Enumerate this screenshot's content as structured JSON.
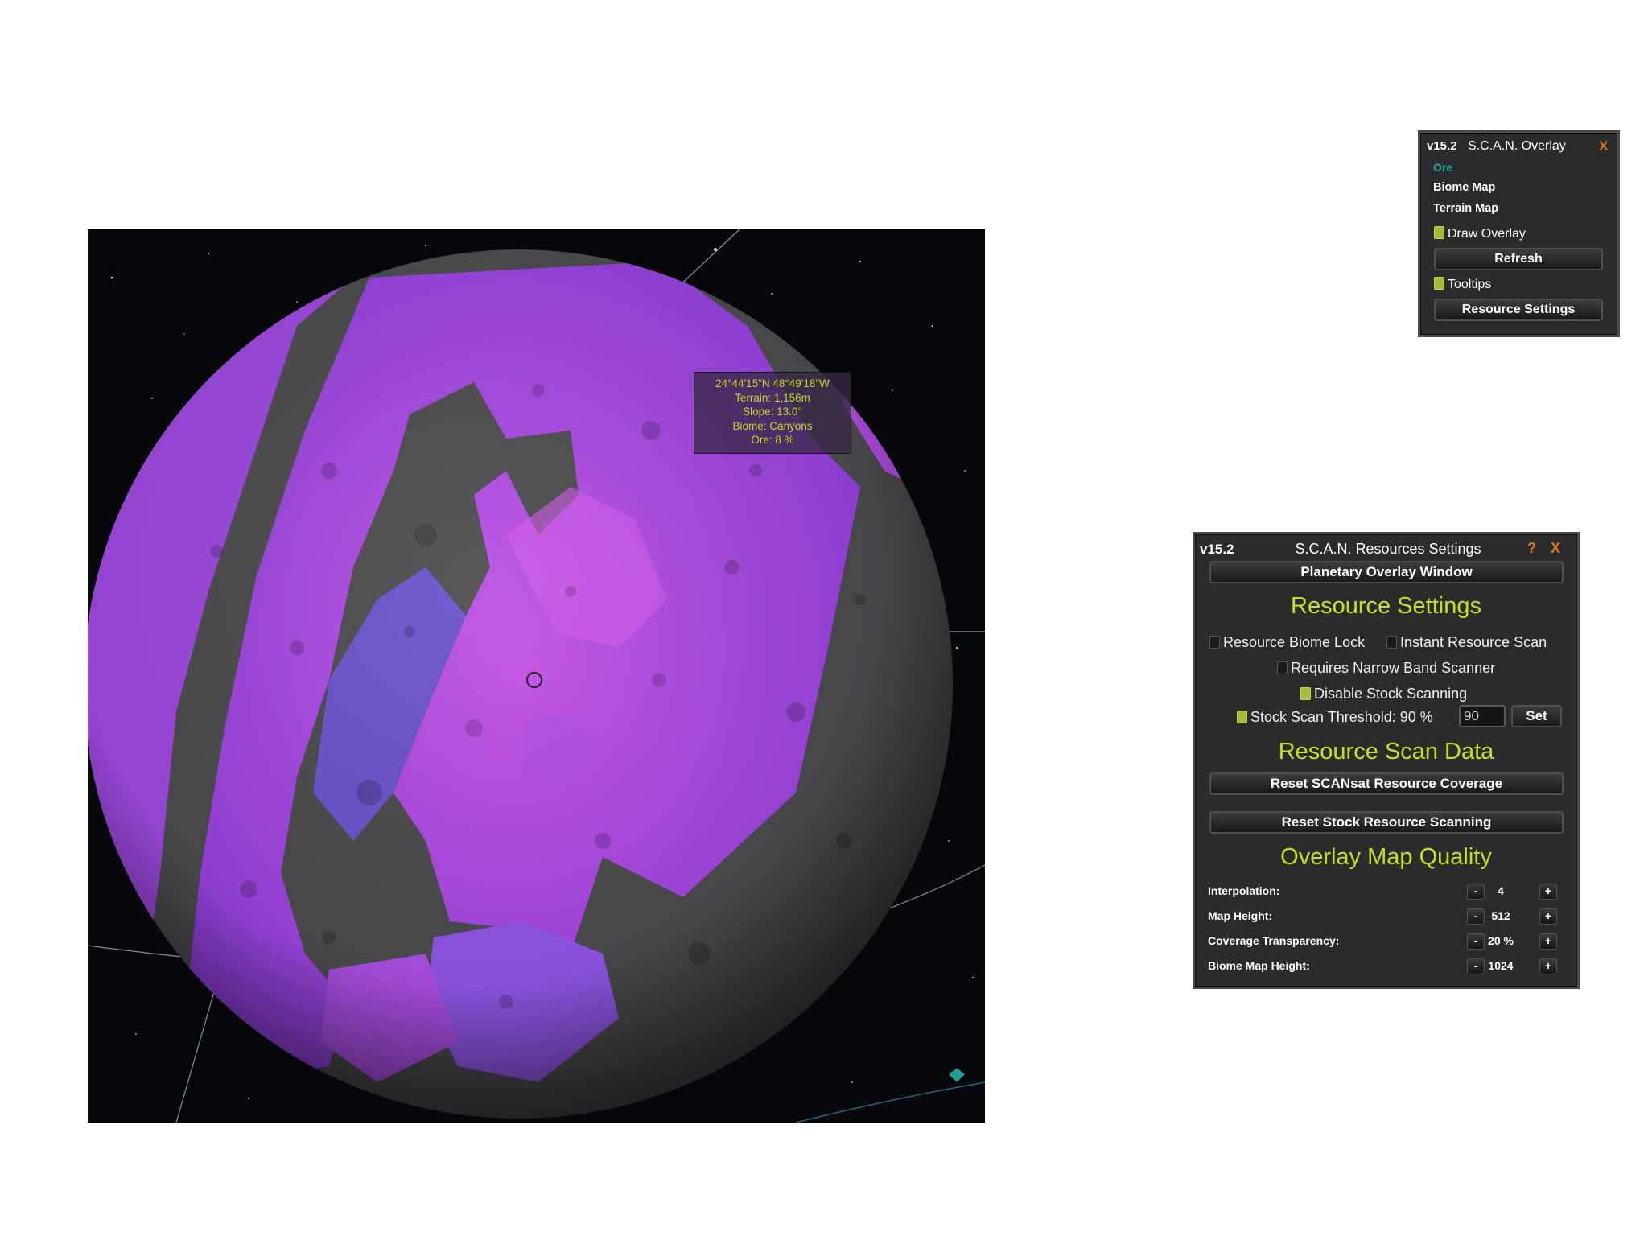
{
  "tooltip": {
    "coords": "24°44'15\"N 48°49'18\"W",
    "terrain": "Terrain: 1,156m",
    "slope": "Slope: 13.0°",
    "biome": "Biome: Canyons",
    "ore": "Ore: 8 %"
  },
  "overlay_window": {
    "version": "v15.2",
    "title": "S.C.A.N. Overlay",
    "close": "X",
    "resource": "Ore",
    "items": [
      "Biome Map",
      "Terrain Map"
    ],
    "draw_overlay": "Draw Overlay",
    "refresh": "Refresh",
    "tooltips": "Tooltips",
    "resource_settings": "Resource Settings"
  },
  "resource_window": {
    "version": "v15.2",
    "title": "S.C.A.N. Resources Settings",
    "help": "?",
    "close": "X",
    "planetary_overlay_button": "Planetary Overlay Window",
    "section_settings": "Resource Settings",
    "biome_lock": "Resource Biome Lock",
    "instant_scan": "Instant Resource Scan",
    "narrow_band": "Requires Narrow Band Scanner",
    "disable_stock": "Disable Stock Scanning",
    "stock_threshold": "Stock Scan Threshold: 90 %",
    "threshold_input": "90",
    "set_button": "Set",
    "section_scan_data": "Resource Scan Data",
    "reset_scansat": "Reset SCANsat Resource Coverage",
    "reset_stock": "Reset Stock Resource Scanning",
    "section_quality": "Overlay Map Quality",
    "quality_rows": [
      {
        "label": "Interpolation:",
        "value": "4"
      },
      {
        "label": "Map Height:",
        "value": "512"
      },
      {
        "label": "Coverage Transparency:",
        "value": "20 %"
      },
      {
        "label": "Biome Map Height:",
        "value": "1024"
      }
    ],
    "minus": "-",
    "plus": "+"
  },
  "colors": {
    "accent_green": "#c6e02a",
    "close_orange": "#e07a18",
    "resource_teal": "#1fa89a",
    "overlay_purple": "#b340e0",
    "overlay_blue": "#7a55e8",
    "terrain_gray": "#4a4a4a"
  }
}
